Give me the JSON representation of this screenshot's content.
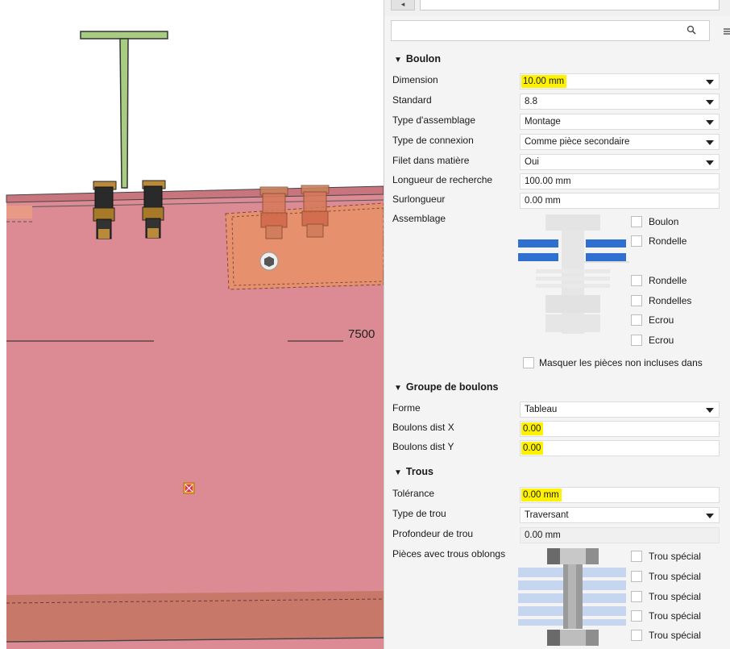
{
  "viewport": {
    "dimension_label": "7500"
  },
  "panel": {
    "search": {
      "value": "",
      "placeholder": ""
    },
    "boulon": {
      "title": "Boulon",
      "rows": [
        {
          "label": "Dimension",
          "value": "10.00 mm",
          "dropdown": true,
          "highlight": true
        },
        {
          "label": "Standard",
          "value": "8.8",
          "dropdown": true
        },
        {
          "label": "Type d'assemblage",
          "value": "Montage",
          "dropdown": true
        },
        {
          "label": "Type de connexion",
          "value": "Comme pièce secondaire",
          "dropdown": true
        },
        {
          "label": "Filet dans matière",
          "value": "Oui",
          "dropdown": true
        },
        {
          "label": "Longueur de recherche",
          "value": "100.00 mm"
        },
        {
          "label": "Surlongueur",
          "value": "0.00 mm"
        }
      ],
      "assemblage_label": "Assemblage",
      "assemblage_checks": [
        "Boulon",
        "Rondelle",
        "Rondelle",
        "Rondelles",
        "Ecrou",
        "Ecrou"
      ],
      "masquer_label": "Masquer les pièces non incluses dans"
    },
    "groupe": {
      "title": "Groupe de boulons",
      "forme_label": "Forme",
      "forme_value": "Tableau",
      "dist_x_label": "Boulons dist X",
      "dist_x_value": "0.00",
      "dist_y_label": "Boulons dist Y",
      "dist_y_value": "0.00"
    },
    "trous": {
      "title": "Trous",
      "tolerance_label": "Tolérance",
      "tolerance_value": "0.00 mm",
      "type_label": "Type de trou",
      "type_value": "Traversant",
      "profondeur_label": "Profondeur de trou",
      "profondeur_value": "0.00 mm",
      "oblongs_label": "Pièces avec trous oblongs",
      "special_checks": [
        "Trou spécial",
        "Trou spécial",
        "Trou spécial",
        "Trou spécial",
        "Trou spécial"
      ]
    }
  },
  "colors": {
    "highlight": "#fff200",
    "beam_pink": "#dc8a93",
    "plate_orange": "#e6906e",
    "tee_green": "#a9cc83",
    "washer_blue": "#2f6fd0"
  }
}
